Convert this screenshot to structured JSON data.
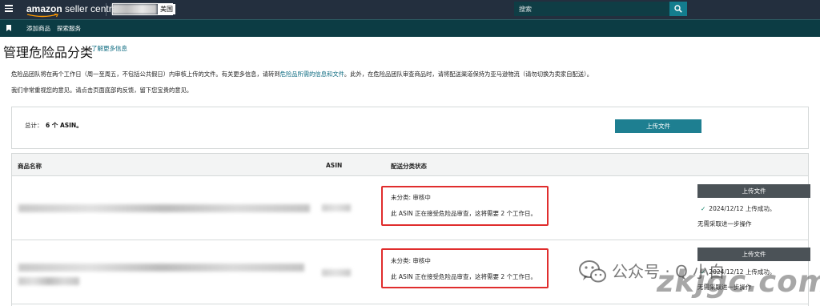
{
  "topbar": {
    "logo_brand": "amazon",
    "logo_product": " seller central",
    "marketplace": "美国",
    "search_placeholder": "搜索"
  },
  "nav": {
    "items": [
      {
        "label": "添加商品"
      },
      {
        "label": "探索服务"
      }
    ]
  },
  "page": {
    "title": "管理危险品分类",
    "learn_more": "了解更多信息",
    "intro_1_pre": "危险品团队将在两个工作日（周一至周五，不包括公共假日）内审核上传的文件。有关更多信息，请转到",
    "intro_1_link": "危险品所需的信息和文件",
    "intro_1_post": "。此外，在危险品团队审查商品时，请将配送渠道保持为亚马逊物流（请勿切换为卖家自配送）。",
    "intro_2": "我们非常重视您的意见。请点击页面底部的反馈，留下您宝贵的意见。"
  },
  "summary": {
    "total_label": "总计：",
    "total_value": "6 个 ASIN。",
    "upload_label": "上传文件"
  },
  "table": {
    "headers": {
      "name": "商品名称",
      "asin": "ASIN",
      "status": "配送分类状态"
    },
    "rows": [
      {
        "status_title": "未分类: 审核中",
        "status_desc": "此 ASIN 正在接受危险品审查，这将需要 2 个工作日。",
        "upload_label": "上传文件",
        "success_text": "2024/12/12 上传成功。",
        "next_text": "无需采取进一步操作"
      },
      {
        "status_title": "未分类: 审核中",
        "status_desc": "此 ASIN 正在接受危险品审查，这将需要 2 个工作日。",
        "upload_label": "上传文件",
        "success_text": "2024/12/12 上传成功。",
        "next_text": "无需采取进一步操作"
      }
    ]
  },
  "watermark": {
    "text": "公众号 · Q 小白",
    "site": "zkjgc.com"
  },
  "colors": {
    "topbar": "#232f3e",
    "navbar": "#0c3c44",
    "accent": "#1e7f91",
    "link": "#0d6b80",
    "highlight": "#e02d2d",
    "row_button": "#4b5257"
  },
  "icons": [
    "menu-icon",
    "search-icon",
    "bookmark-icon",
    "check-icon",
    "wechat-icon"
  ]
}
